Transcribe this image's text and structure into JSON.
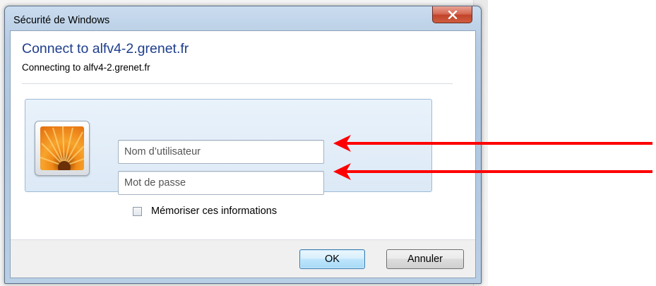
{
  "window": {
    "title": "Sécurité de Windows",
    "close_icon": "close-icon"
  },
  "dialog": {
    "heading": "Connect to alfv4-2.grenet.fr",
    "subheading": "Connecting to alfv4-2.grenet.fr"
  },
  "credentials": {
    "avatar_icon": "user-avatar-flower-icon",
    "username_placeholder": "Nom d’utilisateur",
    "username_value": "",
    "password_placeholder": "Mot de passe",
    "password_value": "",
    "remember_label": "Mémoriser ces informations",
    "remember_checked": false
  },
  "buttons": {
    "ok_label": "OK",
    "cancel_label": "Annuler"
  },
  "annotations": {
    "arrow_color": "#ff0000",
    "arrow_targets": [
      "username-field",
      "password-field"
    ]
  },
  "colors": {
    "heading": "#1e3e8c",
    "close_button": "#c2442a",
    "panel": "#dce9f6"
  }
}
